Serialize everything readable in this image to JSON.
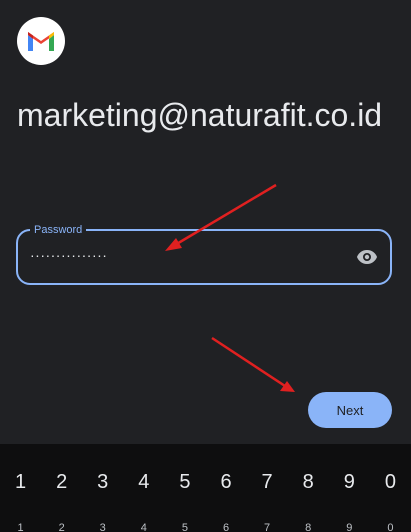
{
  "header": {
    "logo_icon": "gmail-logo-icon"
  },
  "account": {
    "email": "marketing@naturafit.co.id"
  },
  "password_field": {
    "label": "Password",
    "value": "···············",
    "toggle_icon": "eye-icon",
    "focus_color": "#8ab4f8"
  },
  "actions": {
    "next_label": "Next"
  },
  "annotations": {
    "arrow_color": "#e02020",
    "arrow_count": 2
  },
  "keyboard": {
    "number_row": [
      "1",
      "2",
      "3",
      "4",
      "5",
      "6",
      "7",
      "8",
      "9",
      "0"
    ],
    "lower_row": [
      "1",
      "2",
      "3",
      "4",
      "5",
      "6",
      "7",
      "8",
      "9",
      "0"
    ]
  },
  "colors": {
    "background": "#202124",
    "accent": "#8ab4f8",
    "keyboard": "#0e0e0f"
  }
}
